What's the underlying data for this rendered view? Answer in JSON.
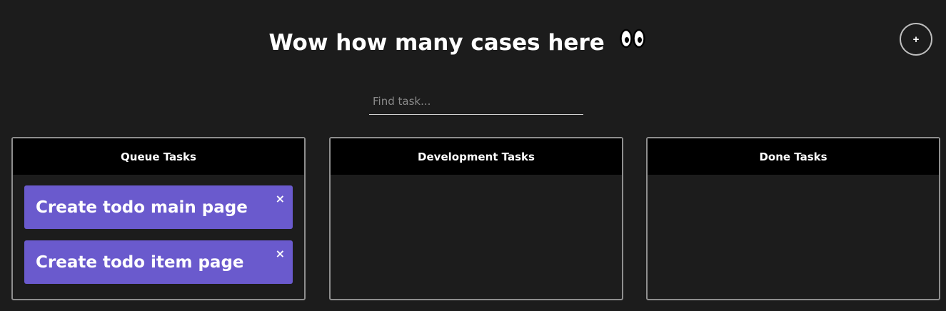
{
  "header": {
    "title": "Wow how many cases here"
  },
  "add_button": {
    "label": "+"
  },
  "search": {
    "placeholder": "Find task...",
    "value": ""
  },
  "columns": [
    {
      "title": "Queue Tasks",
      "tasks": [
        {
          "label": "Create todo main page",
          "close": "×"
        },
        {
          "label": "Create todo item page",
          "close": "×"
        }
      ]
    },
    {
      "title": "Development Tasks",
      "tasks": []
    },
    {
      "title": "Done Tasks",
      "tasks": []
    }
  ],
  "colors": {
    "background": "#1c1c1c",
    "task_bg": "#6a5acd",
    "header_bg": "#000000",
    "border": "#8e8e8e"
  },
  "icons": {
    "title_emoji": "eyes-icon",
    "add": "plus-icon",
    "remove": "close-icon"
  }
}
